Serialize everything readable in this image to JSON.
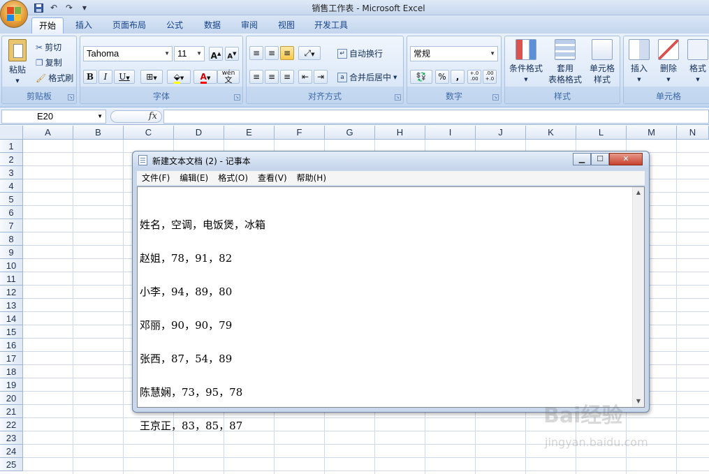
{
  "app": {
    "title": "销售工作表 - Microsoft Excel"
  },
  "tabs": [
    "开始",
    "插入",
    "页面布局",
    "公式",
    "数据",
    "审阅",
    "视图",
    "开发工具"
  ],
  "ribbon": {
    "clipboard": {
      "label": "剪贴板",
      "paste": "粘贴",
      "cut": "剪切",
      "copy": "复制",
      "format_painter": "格式刷"
    },
    "font": {
      "label": "字体",
      "name": "Tahoma",
      "size": "11",
      "bold": "B",
      "italic": "I",
      "underline": "U",
      "grow": "A",
      "shrink": "A",
      "phonetic": "wén"
    },
    "alignment": {
      "label": "对齐方式",
      "wrap": "自动换行",
      "merge": "合并后居中"
    },
    "number": {
      "label": "数字",
      "format": "常规",
      "percent": "%",
      "comma": ",",
      "inc_decimal": "+.0\n.00",
      "dec_decimal": ".00\n+.0"
    },
    "styles": {
      "label": "样式",
      "conditional": "条件格式",
      "table_line1": "套用",
      "table_line2": "表格格式",
      "cell_line1": "单元格",
      "cell_line2": "样式"
    },
    "cells": {
      "label": "单元格",
      "insert": "插入",
      "delete": "删除",
      "format": "格式"
    }
  },
  "formula_bar": {
    "name_box": "E20",
    "fx": "fx",
    "value": ""
  },
  "columns": [
    "A",
    "B",
    "C",
    "D",
    "E",
    "F",
    "G",
    "H",
    "I",
    "J",
    "K",
    "L",
    "M",
    "N"
  ],
  "rows": [
    "1",
    "2",
    "3",
    "4",
    "5",
    "6",
    "7",
    "8",
    "9",
    "10",
    "11",
    "12",
    "13",
    "14",
    "15",
    "16",
    "17",
    "18",
    "19",
    "20",
    "21",
    "22",
    "23",
    "24",
    "25"
  ],
  "notepad": {
    "title": "新建文本文档 (2) - 记事本",
    "menus": [
      "文件(F)",
      "编辑(E)",
      "格式(O)",
      "查看(V)",
      "帮助(H)"
    ],
    "lines": [
      "姓名，空调，电饭煲，冰箱",
      "赵姐，78，91，82",
      "小李，94，89，80",
      "邓丽，90，90，79",
      "张西，87，54，89",
      "陈慧娴，73，95，78",
      "王京正，83，85，87"
    ]
  },
  "watermark": {
    "logo": "Bai经验",
    "url": "jingyan.baidu.com"
  }
}
